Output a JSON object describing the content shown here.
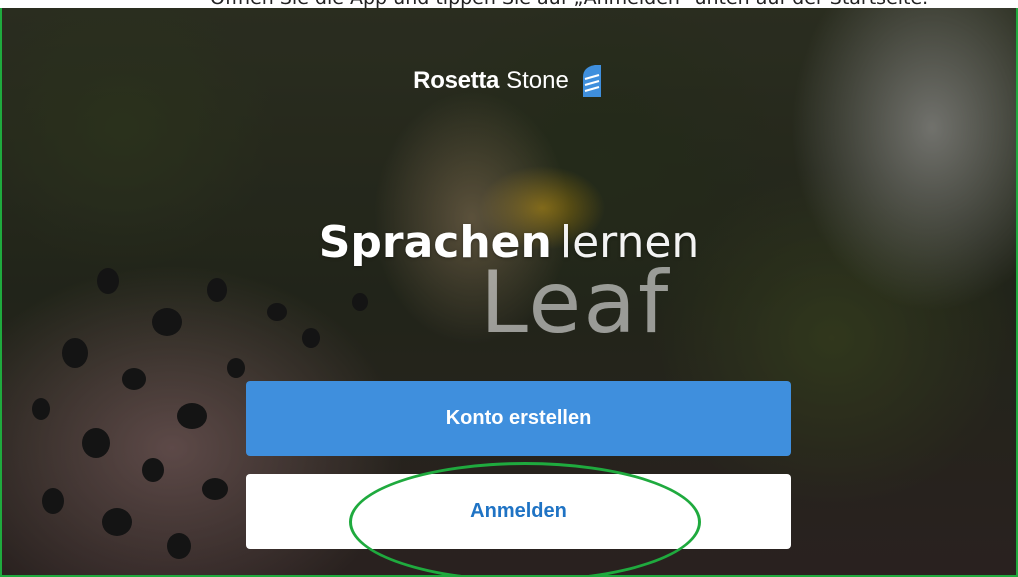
{
  "caption": {
    "text": "Öffnen Sie die App und tippen Sie auf „Anmelden“ unten auf der Startseite."
  },
  "brand": {
    "name_part1": "Rosetta",
    "name_part2": "Stone"
  },
  "headline": {
    "strong": "Sprachen",
    "light": "lernen"
  },
  "watermark": {
    "text": "Leaf"
  },
  "buttons": {
    "create_account": "Konto erstellen",
    "sign_in": "Anmelden"
  },
  "colors": {
    "primary_button": "#3f8fdd",
    "secondary_button_text": "#1f73c4",
    "highlight": "#1faa3e",
    "logo_accent": "#3f8fdd"
  },
  "icons": {
    "logo": "rosetta-stone-logo-icon"
  }
}
